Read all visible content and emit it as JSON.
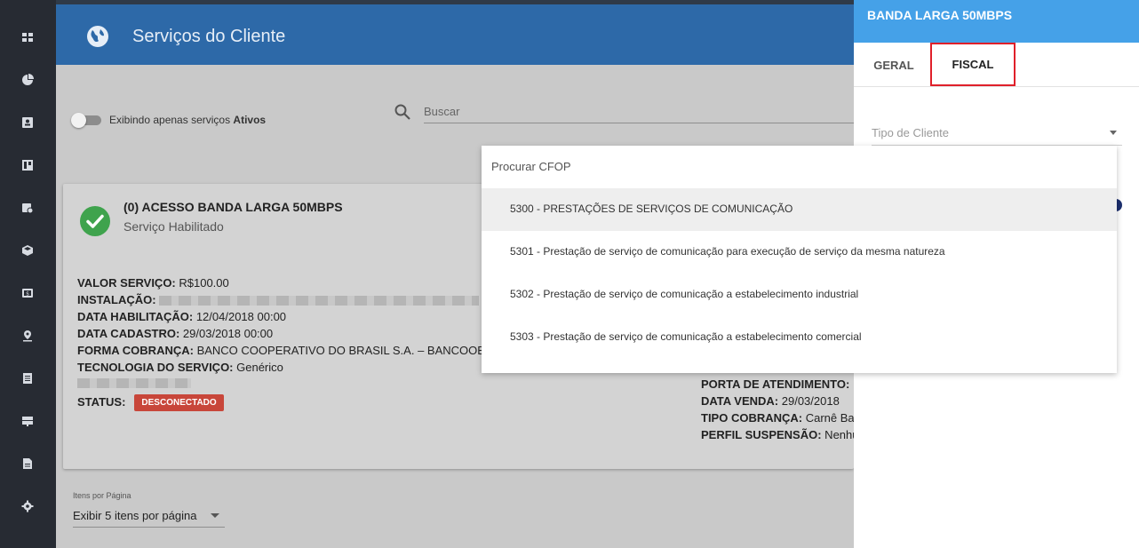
{
  "header": {
    "title": "Serviços do Cliente"
  },
  "toggle": {
    "label_prefix": "Exibindo apenas serviços ",
    "label_bold": "Ativos"
  },
  "search": {
    "placeholder": "Buscar"
  },
  "service": {
    "title": "(0) ACESSO BANDA LARGA 50MBPS",
    "subtitle": "Serviço Habilitado",
    "fields": [
      {
        "label": "VALOR SERVIÇO:",
        "value": " R$100.00"
      },
      {
        "label": "INSTALAÇÃO:",
        "value": ""
      },
      {
        "label": "DATA HABILITAÇÃO:",
        "value": " 12/04/2018 00:00"
      },
      {
        "label": "DATA CADASTRO:",
        "value": " 29/03/2018 00:00"
      },
      {
        "label": "FORMA COBRANÇA:",
        "value": " BANCO COOPERATIVO DO BRASIL S.A. – BANCOOB"
      },
      {
        "label": "TECNOLOGIA DO SERVIÇO:",
        "value": " Genérico"
      }
    ],
    "status_label": "STATUS:",
    "status_badge": "DESCONECTADO",
    "right_fields": [
      {
        "label": "PORTA DE ATENDIMENTO:",
        "value": " "
      },
      {
        "label": "DATA VENDA:",
        "value": " 29/03/2018"
      },
      {
        "label": "TIPO COBRANÇA:",
        "value": " Carnê Ba"
      },
      {
        "label": "PERFIL SUSPENSÃO:",
        "value": " Nenhu"
      }
    ]
  },
  "pagination": {
    "label": "Itens por Página",
    "value": "Exibir 5 itens por página"
  },
  "panel": {
    "title": "BANDA LARGA 50MBPS",
    "tabs": [
      {
        "label": "GERAL"
      },
      {
        "label": "FISCAL"
      }
    ],
    "tipo_cliente_placeholder": "Tipo de Cliente"
  },
  "cfop_dropdown": {
    "search_placeholder": "Procurar CFOP",
    "items": [
      "5300 - PRESTAÇÕES DE SERVIÇOS DE COMUNICAÇÃO",
      "5301 - Prestação de serviço de comunicação para execução de serviço da mesma natureza",
      "5302 - Prestação de serviço de comunicação a estabelecimento industrial",
      "5303 - Prestação de serviço de comunicação a estabelecimento comercial"
    ],
    "highlighted_index": 0
  },
  "sidebar": {
    "icons": [
      "dashboard-icon",
      "pie-chart-icon",
      "contact-card-icon",
      "board-icon",
      "calendar-clock-icon",
      "box-icon",
      "money-icon",
      "location-icon",
      "list-icon",
      "server-icon",
      "document-icon",
      "settings-icon"
    ]
  },
  "colors": {
    "header": "#2d69a8",
    "panel_head": "#45a1e8",
    "sidebar": "#272b33",
    "status_badge": "#c8463a",
    "check": "#3fa34d",
    "tab_highlight": "#e0202a"
  }
}
